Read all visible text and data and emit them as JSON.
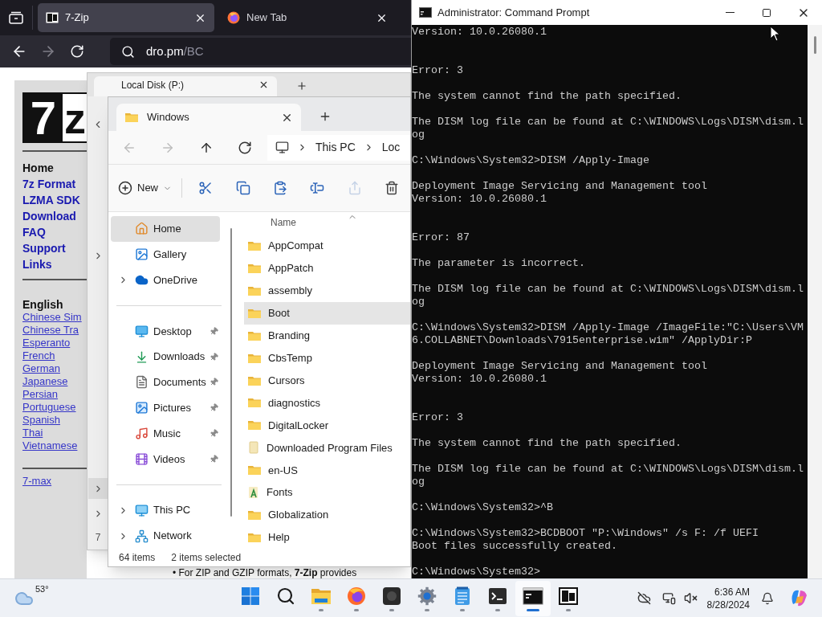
{
  "browser": {
    "tabs": [
      {
        "title": "7-Zip",
        "kind": "archive",
        "selected": true
      },
      {
        "title": "New Tab",
        "kind": "firefox",
        "selected": false
      }
    ],
    "url": {
      "host": "dro.pm",
      "path": "/BC"
    },
    "page": {
      "logo": {
        "dark": "7",
        "light": "z"
      },
      "nav": [
        {
          "label": "Home",
          "selected": true
        },
        {
          "label": "7z Format",
          "selected": false
        },
        {
          "label": "LZMA SDK",
          "selected": false
        },
        {
          "label": "Download",
          "selected": false
        },
        {
          "label": "FAQ",
          "selected": false
        },
        {
          "label": "Support",
          "selected": false
        },
        {
          "label": "Links",
          "selected": false
        }
      ],
      "language_heading": "English",
      "languages": [
        "Chinese Sim",
        "Chinese Tra",
        "Esperanto",
        "French",
        "German",
        "Japanese",
        "Persian",
        "Portuguese",
        "Spanish",
        "Thai",
        "Vietnamese"
      ],
      "extra_link": "7-max",
      "body_text": "• For ZIP and GZIP formats, **7-Zip** provides"
    }
  },
  "back_explorer": {
    "tab_title": "Local Disk (P:)",
    "status_partial": "7"
  },
  "explorer": {
    "tab_title": "Windows",
    "nav_buttons": [
      {
        "kind": "back",
        "disabled": true
      },
      {
        "kind": "forward",
        "disabled": true
      },
      {
        "kind": "up",
        "disabled": false
      },
      {
        "kind": "refresh",
        "disabled": false
      }
    ],
    "breadcrumb": [
      "This PC",
      "Loc"
    ],
    "new_label": "New",
    "actions": [
      {
        "kind": "cut",
        "disabled": false
      },
      {
        "kind": "copy",
        "disabled": false
      },
      {
        "kind": "paste",
        "disabled": false
      },
      {
        "kind": "rename",
        "disabled": false
      },
      {
        "kind": "share",
        "disabled": true
      },
      {
        "kind": "delete",
        "disabled": false
      }
    ],
    "nav_groups": [
      [
        {
          "label": "Home",
          "kind": "home",
          "selected": true,
          "expandable": false,
          "pinned": false
        },
        {
          "label": "Gallery",
          "kind": "gallery",
          "selected": false,
          "expandable": false,
          "pinned": false
        },
        {
          "label": "OneDrive",
          "kind": "cloud",
          "selected": false,
          "expandable": true,
          "pinned": false
        }
      ],
      [
        {
          "label": "Desktop",
          "kind": "desktop",
          "selected": false,
          "expandable": false,
          "pinned": true
        },
        {
          "label": "Downloads",
          "kind": "downloads",
          "selected": false,
          "expandable": false,
          "pinned": true
        },
        {
          "label": "Documents",
          "kind": "documents",
          "selected": false,
          "expandable": false,
          "pinned": true
        },
        {
          "label": "Pictures",
          "kind": "pictures",
          "selected": false,
          "expandable": false,
          "pinned": true
        },
        {
          "label": "Music",
          "kind": "music",
          "selected": false,
          "expandable": false,
          "pinned": true
        },
        {
          "label": "Videos",
          "kind": "videos",
          "selected": false,
          "expandable": false,
          "pinned": true
        }
      ],
      [
        {
          "label": "This PC",
          "kind": "pc",
          "selected": false,
          "expandable": true,
          "pinned": false
        },
        {
          "label": "Network",
          "kind": "network",
          "selected": false,
          "expandable": true,
          "pinned": false
        }
      ]
    ],
    "column": "Name",
    "files": [
      {
        "name": "AppCompat",
        "kind": "folder",
        "selected": false
      },
      {
        "name": "AppPatch",
        "kind": "folder",
        "selected": false
      },
      {
        "name": "assembly",
        "kind": "folder",
        "selected": false
      },
      {
        "name": "Boot",
        "kind": "folder",
        "selected": true
      },
      {
        "name": "Branding",
        "kind": "folder",
        "selected": false
      },
      {
        "name": "CbsTemp",
        "kind": "folder",
        "selected": false
      },
      {
        "name": "Cursors",
        "kind": "folder",
        "selected": false
      },
      {
        "name": "diagnostics",
        "kind": "folder",
        "selected": false
      },
      {
        "name": "DigitalLocker",
        "kind": "folder",
        "selected": false
      },
      {
        "name": "Downloaded Program Files",
        "kind": "special",
        "selected": false
      },
      {
        "name": "en-US",
        "kind": "folder",
        "selected": false
      },
      {
        "name": "Fonts",
        "kind": "fonts",
        "selected": false
      },
      {
        "name": "Globalization",
        "kind": "folder",
        "selected": false
      },
      {
        "name": "Help",
        "kind": "folder",
        "selected": false
      }
    ],
    "status": {
      "count": "64 items",
      "selected": "2 items selected"
    }
  },
  "cmd": {
    "title": "Administrator: Command Prompt",
    "blocks": [
      {
        "kind": "banner",
        "lines": [
          "Version: 10.0.26080.1"
        ]
      },
      {
        "kind": "text",
        "lines": [
          "Error: 3"
        ]
      },
      {
        "kind": "text",
        "lines": [
          "The system cannot find the path specified."
        ]
      },
      {
        "kind": "text",
        "lines": [
          "The DISM log file can be found at C:\\WINDOWS\\Logs\\DISM\\dism.l",
          "og"
        ]
      },
      {
        "kind": "text",
        "lines": [
          "C:\\Windows\\System32>DISM /Apply-Image"
        ]
      },
      {
        "kind": "banner",
        "lines": [
          "Deployment Image Servicing and Management tool",
          "Version: 10.0.26080.1"
        ]
      },
      {
        "kind": "text",
        "lines": [
          "Error: 87"
        ]
      },
      {
        "kind": "text",
        "lines": [
          "The parameter is incorrect."
        ]
      },
      {
        "kind": "text",
        "lines": [
          "The DISM log file can be found at C:\\WINDOWS\\Logs\\DISM\\dism.l",
          "og"
        ]
      },
      {
        "kind": "text",
        "lines": [
          "C:\\Windows\\System32>DISM /Apply-Image /ImageFile:\"C:\\Users\\VM",
          "6.COLLABNET\\Downloads\\7915enterprise.wim\" /ApplyDir:P"
        ]
      },
      {
        "kind": "banner",
        "lines": [
          "Deployment Image Servicing and Management tool",
          "Version: 10.0.26080.1"
        ]
      },
      {
        "kind": "text",
        "lines": [
          "Error: 3"
        ]
      },
      {
        "kind": "text",
        "lines": [
          "The system cannot find the path specified."
        ]
      },
      {
        "kind": "text",
        "lines": [
          "The DISM log file can be found at C:\\WINDOWS\\Logs\\DISM\\dism.l",
          "og"
        ]
      },
      {
        "kind": "text",
        "lines": [
          "C:\\Windows\\System32>^B"
        ]
      },
      {
        "kind": "text",
        "lines": [
          "C:\\Windows\\System32>BCDBOOT \"P:\\Windows\" /s F: /f UEFI",
          "Boot files successfully created."
        ]
      },
      {
        "kind": "text",
        "lines": [
          "C:\\Windows\\System32>"
        ]
      }
    ]
  },
  "taskbar": {
    "weather": "53°",
    "apps": [
      {
        "kind": "start",
        "running": false,
        "active": false
      },
      {
        "kind": "search",
        "running": false,
        "active": false
      },
      {
        "kind": "explorer",
        "running": true,
        "active": false
      },
      {
        "kind": "firefox",
        "running": true,
        "active": false
      },
      {
        "kind": "dark",
        "running": true,
        "active": false
      },
      {
        "kind": "settings",
        "running": true,
        "active": false
      },
      {
        "kind": "notepad",
        "running": true,
        "active": false
      },
      {
        "kind": "terminal",
        "running": true,
        "active": false
      },
      {
        "kind": "cmd",
        "running": true,
        "active": true
      },
      {
        "kind": "archiver",
        "running": true,
        "active": false
      }
    ],
    "time": "6:36 AM",
    "date": "8/28/2024"
  }
}
